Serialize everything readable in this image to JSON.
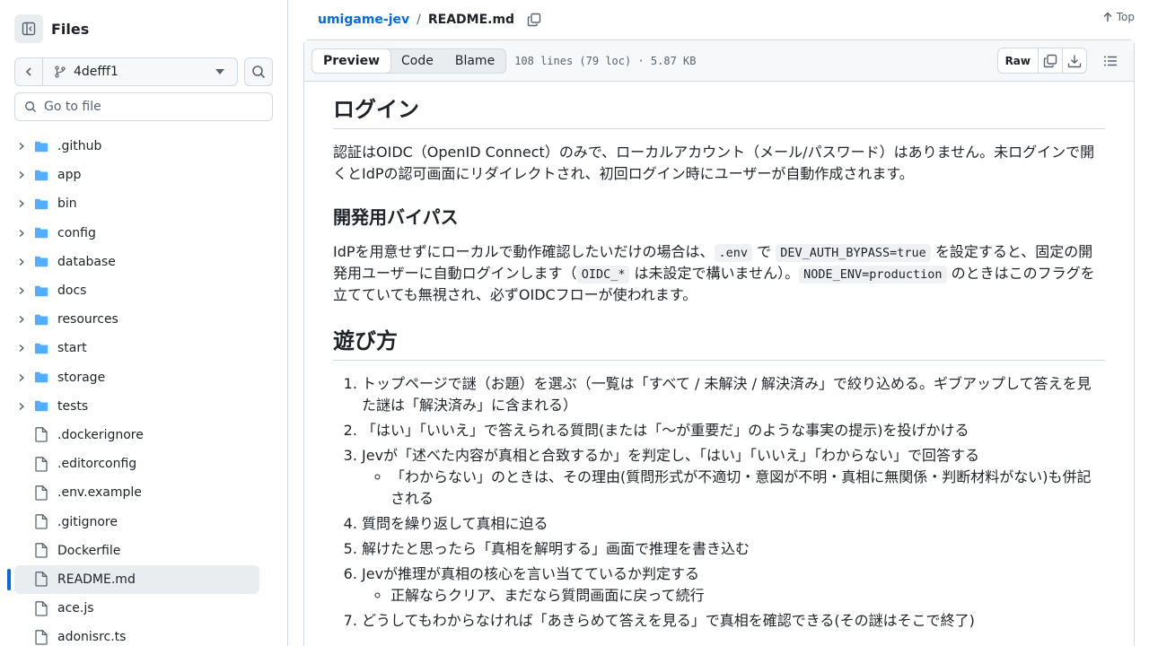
{
  "sidebar": {
    "title": "Files",
    "branch": "4defff1",
    "goto_placeholder": "Go to file",
    "folders": [
      ".github",
      "app",
      "bin",
      "config",
      "database",
      "docs",
      "resources",
      "start",
      "storage",
      "tests"
    ],
    "files": [
      ".dockerignore",
      ".editorconfig",
      ".env.example",
      ".gitignore",
      "Dockerfile",
      "README.md",
      "ace.js",
      "adonisrc.ts"
    ],
    "selected_file": "README.md"
  },
  "breadcrumb": {
    "repo": "umigame-jev",
    "separator": "/",
    "file": "README.md"
  },
  "top_link": "Top",
  "file_header": {
    "tabs": [
      "Preview",
      "Code",
      "Blame"
    ],
    "active_tab": "Preview",
    "meta": "108 lines (79 loc) · 5.87 KB",
    "raw_label": "Raw"
  },
  "content": {
    "h_login": "ログイン",
    "p_login": "認証はOIDC（OpenID Connect）のみで、ローカルアカウント（メール/パスワード）はありません。未ログインで開くとIdPの認可画面にリダイレクトされ、初回ログイン時にユーザーが自動作成されます。",
    "h_bypass": "開発用バイパス",
    "bypass": {
      "t1": "IdPを用意せずにローカルで動作確認したいだけの場合は、",
      "c1": ".env",
      "t2": " で ",
      "c2": "DEV_AUTH_BYPASS=true",
      "t3": " を設定すると、固定の開発用ユーザーに自動ログインします（",
      "c3": "OIDC_*",
      "t4": " は未設定で構いません）。",
      "c4": "NODE_ENV=production",
      "t5": " のときはこのフラグを立てていても無視され、必ずOIDCフローが使われます。"
    },
    "h_play": "遊び方",
    "steps": {
      "s1": "トップページで謎（お題）を選ぶ（一覧は「すべて / 未解決 / 解決済み」で絞り込める。ギブアップして答えを見た謎は「解決済み」に含まれる）",
      "s2": "「はい」「いいえ」で答えられる質問(または「〜が重要だ」のような事実の提示)を投げかける",
      "s3": "Jevが「述べた内容が真相と合致するか」を判定し、「はい」「いいえ」「わからない」で回答する",
      "s3_sub": "「わからない」のときは、その理由(質問形式が不適切・意図が不明・真相に無関係・判断材料がない)も併記される",
      "s4": "質問を繰り返して真相に迫る",
      "s5": "解けたと思ったら「真相を解明する」画面で推理を書き込む",
      "s6": "Jevが推理が真相の核心を言い当てているか判定する",
      "s6_sub": "正解ならクリア、まだなら質問画面に戻って続行",
      "s7": "どうしてもわからなければ「あきらめて答えを見る」で真相を確認できる(その謎はそこで終了)"
    }
  }
}
